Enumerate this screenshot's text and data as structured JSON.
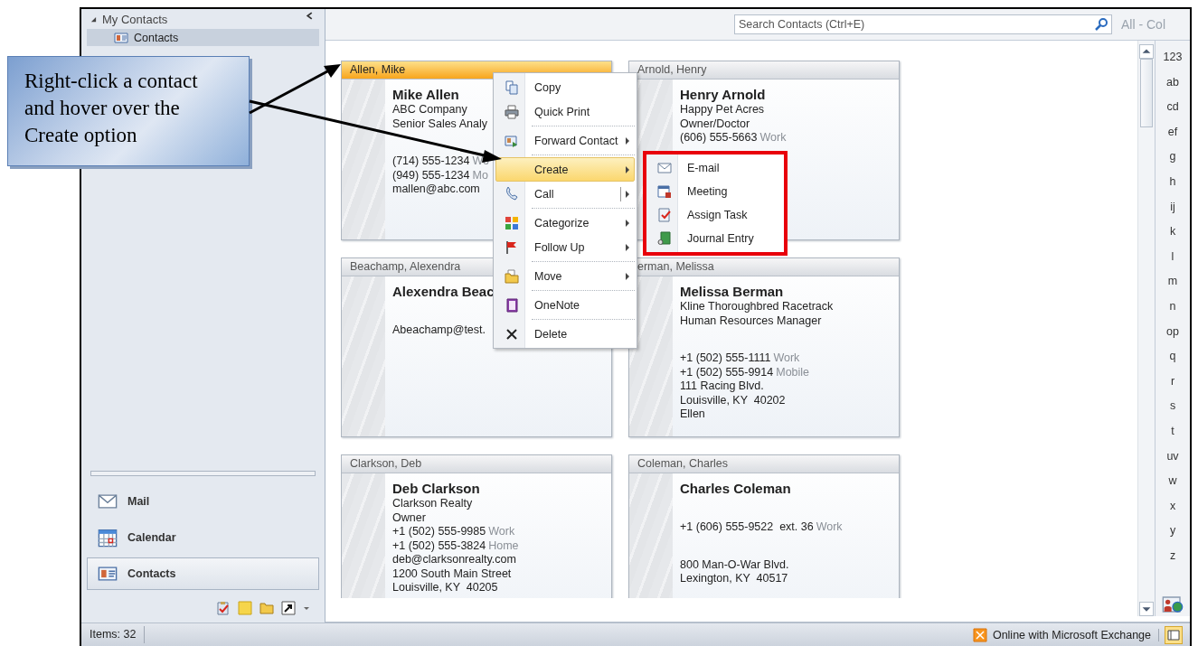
{
  "callout": {
    "text": "Right-click a contact and hover over the Create option"
  },
  "navigation": {
    "group": "My Contacts",
    "folders": [
      {
        "label": "Contacts",
        "selected": true
      }
    ],
    "modules": [
      {
        "label": "Mail",
        "selected": false
      },
      {
        "label": "Calendar",
        "selected": false
      },
      {
        "label": "Contacts",
        "selected": true
      }
    ]
  },
  "search": {
    "placeholder": "Search Contacts (Ctrl+E)",
    "scope": "All - Col"
  },
  "cards": [
    {
      "header": "Allen, Mike",
      "selected": true,
      "name": "Mike Allen",
      "lines": [
        {
          "text": "ABC Company"
        },
        {
          "text": "Senior Sales Analy"
        },
        {
          "text": "(714) 555-1234",
          "label": "Wo",
          "gap": true
        },
        {
          "text": "(949) 555-1234",
          "label": "Mo"
        },
        {
          "text": "mallen@abc.com"
        }
      ]
    },
    {
      "header": "Arnold, Henry",
      "selected": false,
      "name": "Henry Arnold",
      "lines": [
        {
          "text": "Happy Pet Acres"
        },
        {
          "text": "Owner/Doctor"
        },
        {
          "text": "(606) 555-5663",
          "label": "Work"
        }
      ]
    },
    {
      "header": "Beachamp, Alexendra",
      "selected": false,
      "name": "Alexendra Beac",
      "lines": [
        {
          "text": "Abeachamp@test.",
          "gap": true
        }
      ]
    },
    {
      "header": "erman, Melissa",
      "selected": false,
      "name": "Melissa Berman",
      "lines": [
        {
          "text": "Kline Thoroughbred Racetrack"
        },
        {
          "text": "Human Resources Manager"
        },
        {
          "text": "+1 (502) 555-1111",
          "label": "Work",
          "gap": true
        },
        {
          "text": "+1 (502) 555-9914",
          "label": "Mobile"
        },
        {
          "text": "111 Racing Blvd."
        },
        {
          "text": "Louisville, KY  40202"
        },
        {
          "text": "Ellen"
        }
      ]
    },
    {
      "header": "Clarkson, Deb",
      "selected": false,
      "name": "Deb Clarkson",
      "lines": [
        {
          "text": "Clarkson Realty"
        },
        {
          "text": "Owner"
        },
        {
          "text": "+1 (502) 555-9985",
          "label": "Work"
        },
        {
          "text": "+1 (502) 555-3824",
          "label": "Home"
        },
        {
          "text": "deb@clarksonrealty.com"
        },
        {
          "text": "1200 South Main Street"
        },
        {
          "text": "Louisville, KY  40205"
        }
      ]
    },
    {
      "header": "Coleman, Charles",
      "selected": false,
      "name": "Charles Coleman",
      "lines": [
        {
          "text": "+1 (606) 555-9522  ext. 36",
          "label": "Work",
          "gap": true
        },
        {
          "text": "800 Man-O-War Blvd.",
          "gap": true
        },
        {
          "text": "Lexington, KY  40517"
        }
      ]
    }
  ],
  "context_menu": {
    "items": [
      {
        "label": "Copy",
        "kind": "plain",
        "selected": false
      },
      {
        "label": "Quick Print",
        "kind": "plain",
        "selected": false
      },
      {
        "label": "Forward Contact",
        "kind": "submenu",
        "separator": true,
        "selected": false
      },
      {
        "label": "Create",
        "kind": "submenu",
        "separator": true,
        "selected": true
      },
      {
        "label": "Call",
        "kind": "split",
        "selected": false
      },
      {
        "label": "Categorize",
        "kind": "submenu",
        "separator": true,
        "selected": false
      },
      {
        "label": "Follow Up",
        "kind": "submenu",
        "selected": false
      },
      {
        "label": "Move",
        "kind": "submenu",
        "separator": true,
        "selected": false
      },
      {
        "label": "OneNote",
        "kind": "plain",
        "separator": true,
        "selected": false
      },
      {
        "label": "Delete",
        "kind": "plain",
        "separator": true,
        "selected": false
      }
    ]
  },
  "submenu": {
    "highlighted": true,
    "items": [
      {
        "label": "E-mail"
      },
      {
        "label": "Meeting"
      },
      {
        "label": "Assign Task"
      },
      {
        "label": "Journal Entry"
      }
    ]
  },
  "index": [
    "123",
    "ab",
    "cd",
    "ef",
    "g",
    "h",
    "ij",
    "k",
    "l",
    "m",
    "n",
    "op",
    "q",
    "r",
    "s",
    "t",
    "uv",
    "w",
    "x",
    "y",
    "z"
  ],
  "status_bar": {
    "items": "Items: 32",
    "connection": "Online with Microsoft Exchange"
  }
}
